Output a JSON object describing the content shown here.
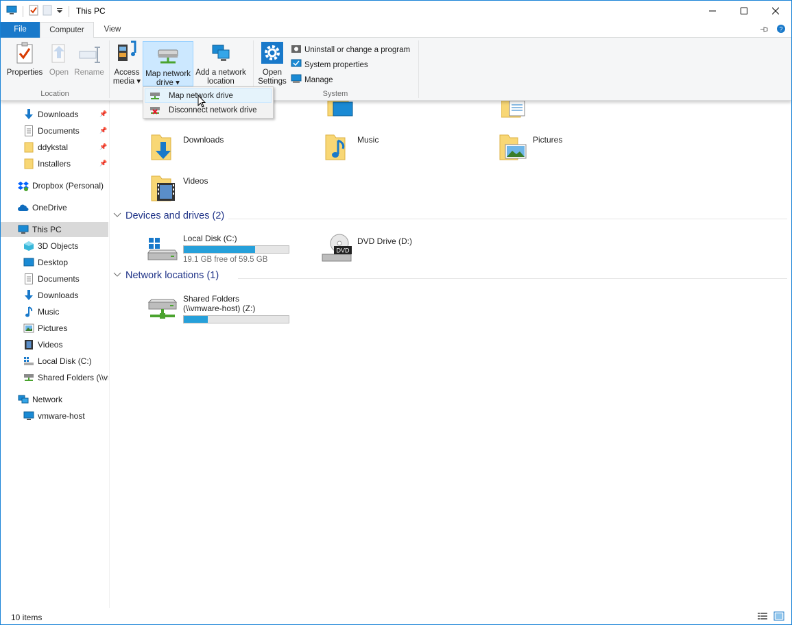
{
  "window": {
    "title": "This PC"
  },
  "tabs": {
    "file": "File",
    "computer": "Computer",
    "view": "View"
  },
  "ribbon": {
    "location": {
      "label": "Location",
      "properties": "Properties",
      "open": "Open",
      "rename": "Rename"
    },
    "network": {
      "access_media_1": "Access",
      "access_media_2": "media",
      "map_drive_1": "Map network",
      "map_drive_2": "drive",
      "add_location_1": "Add a network",
      "add_location_2": "location"
    },
    "system": {
      "label": "System",
      "open_settings_1": "Open",
      "open_settings_2": "Settings",
      "uninstall": "Uninstall or change a program",
      "system_properties": "System properties",
      "manage": "Manage"
    }
  },
  "dropdown": {
    "items": [
      "Map network drive",
      "Disconnect network drive"
    ]
  },
  "nav": {
    "quick": [
      "Downloads",
      "Documents",
      "ddykstal",
      "Installers"
    ],
    "dropbox": "Dropbox (Personal)",
    "onedrive": "OneDrive",
    "this_pc": "This PC",
    "pc_items": [
      "3D Objects",
      "Desktop",
      "Documents",
      "Downloads",
      "Music",
      "Pictures",
      "Videos",
      "Local Disk (C:)",
      "Shared Folders (\\\\vmware-host) (Z:)"
    ],
    "network": "Network",
    "network_items": [
      "vmware-host"
    ]
  },
  "folders": {
    "downloads": "Downloads",
    "music": "Music",
    "pictures": "Pictures",
    "videos": "Videos"
  },
  "devices": {
    "header": "Devices and drives (2)",
    "local_disk": {
      "name": "Local Disk (C:)",
      "free": "19.1 GB free of 59.5 GB",
      "used_fraction": 0.68
    },
    "dvd": {
      "name": "DVD Drive (D:)"
    }
  },
  "network_locations": {
    "header": "Network locations (1)",
    "shared": {
      "name_1": "Shared Folders",
      "name_2": "(\\\\vmware-host) (Z:)",
      "used_fraction": 0.23
    }
  },
  "status": {
    "count": "10 items"
  },
  "colors": {
    "accent": "#1979ca",
    "bar_fill": "#26a0da",
    "section_title": "#1e3287"
  }
}
